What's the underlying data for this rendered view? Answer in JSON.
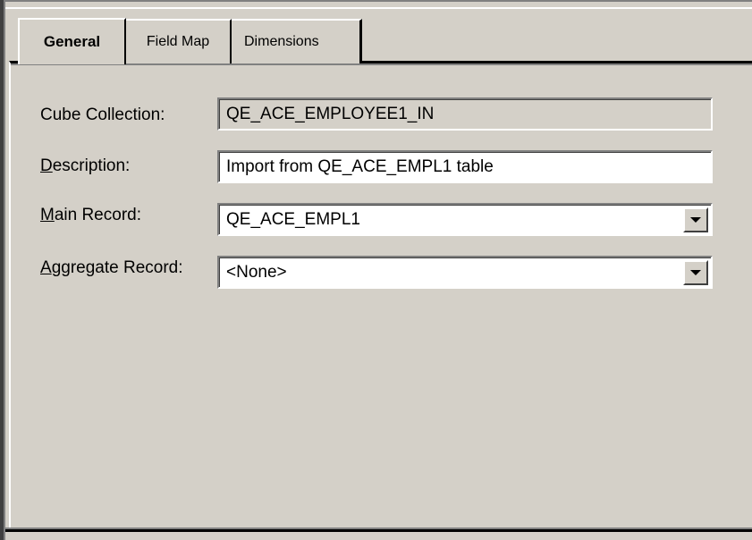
{
  "tabs": {
    "general": "General",
    "field_map": "Field Map",
    "dimensions": "Dimensions"
  },
  "form": {
    "cube_collection": {
      "label": "Cube Collection:",
      "value": "QE_ACE_EMPLOYEE1_IN"
    },
    "description": {
      "label_hotkey": "D",
      "label_rest": "escription:",
      "value": "Import from QE_ACE_EMPL1 table"
    },
    "main_record": {
      "label_hotkey": "M",
      "label_rest": "ain Record:",
      "value": "QE_ACE_EMPL1"
    },
    "aggregate_record": {
      "label_hotkey": "A",
      "label_rest": "ggregate Record:",
      "value": "<None>"
    }
  },
  "icons": {
    "dropdown": "chevron-down-icon"
  },
  "colors": {
    "background": "#d4d0c8",
    "field_bg": "#ffffff"
  }
}
